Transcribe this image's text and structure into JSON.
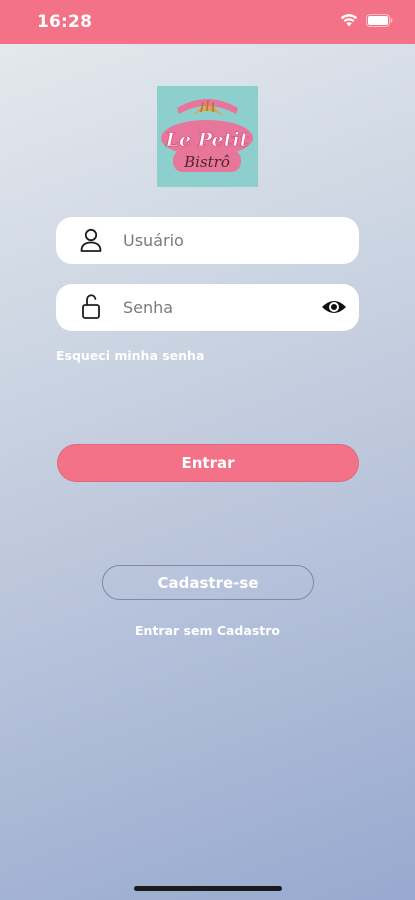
{
  "status_bar": {
    "time": "16:28",
    "icons": [
      "wifi-icon",
      "battery-icon"
    ],
    "background": "#f37287"
  },
  "logo": {
    "line1": "Le Petit",
    "line2": "Bistrô",
    "colors": {
      "background": "#8dcfcc",
      "ribbon": "#e8769a",
      "text_fill": "#ffffff",
      "text_outline": "#d94f7d"
    }
  },
  "login": {
    "username": {
      "placeholder": "Usuário",
      "value": "",
      "icon": "user-icon"
    },
    "password": {
      "placeholder": "Senha",
      "value": "",
      "icon": "lock-open-icon",
      "toggle_icon": "eye-icon"
    },
    "forgot_label": "Esqueci minha senha",
    "submit_label": "Entrar",
    "register_label": "Cadastre-se",
    "guest_label": "Entrar sem Cadastro"
  },
  "theme": {
    "accent": "#f37287",
    "gradient_top": "#e7ebef",
    "gradient_bottom": "#97a9cf"
  }
}
